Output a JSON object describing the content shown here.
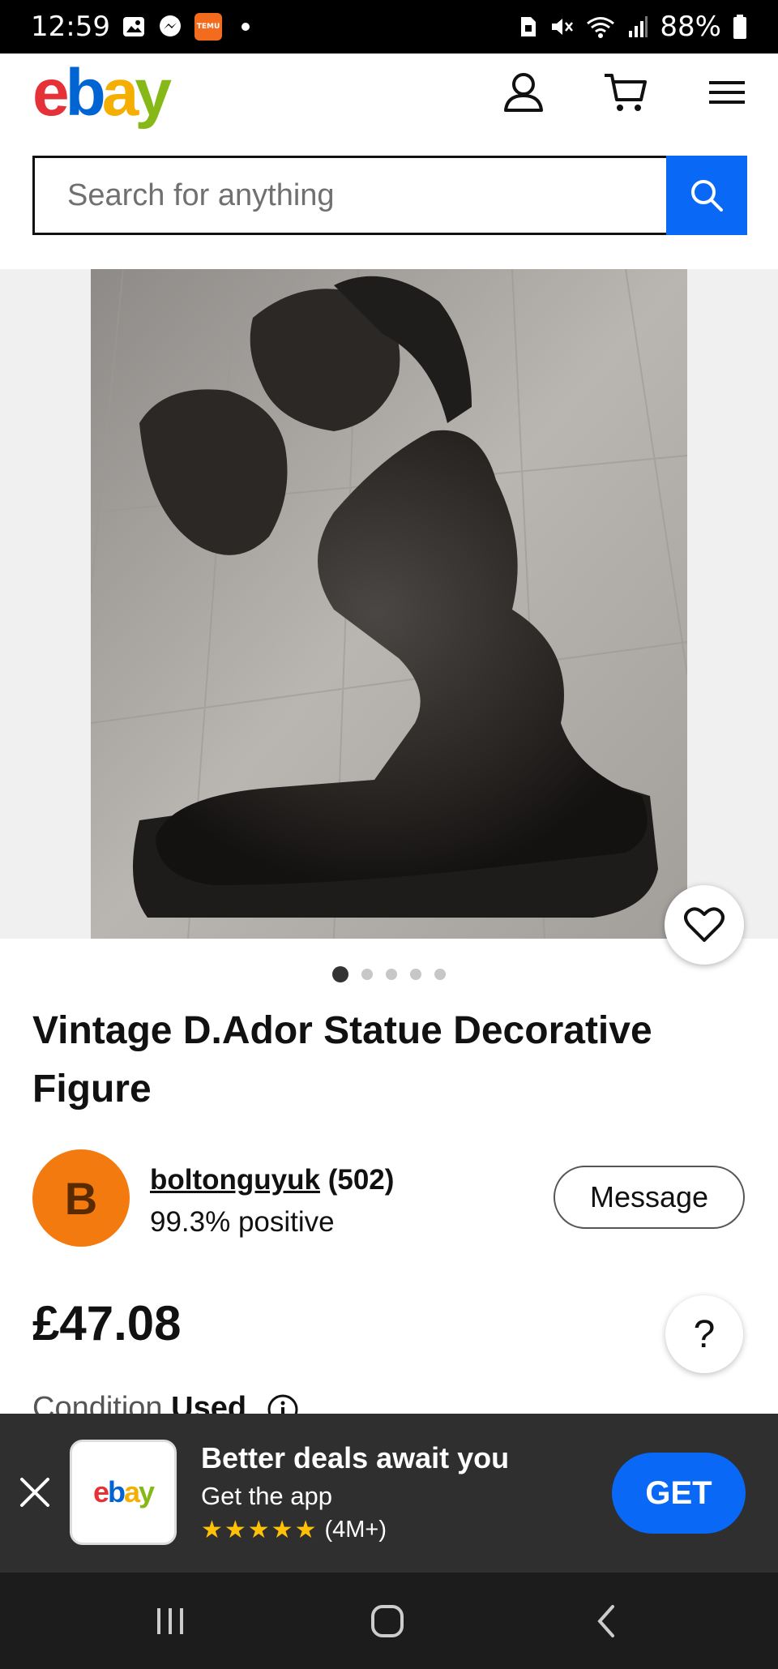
{
  "status_bar": {
    "time": "12:59",
    "battery": "88%",
    "icons": [
      "gallery-icon",
      "messenger-icon",
      "temu-icon",
      "notification-dot",
      "sim-icon",
      "mute-icon",
      "wifi-icon",
      "signal-icon",
      "battery-icon"
    ],
    "temu_label": "TEMU"
  },
  "header": {
    "logo_letters": [
      "e",
      "b",
      "a",
      "y"
    ],
    "icons": [
      "account-icon",
      "cart-icon",
      "menu-icon"
    ]
  },
  "search": {
    "placeholder": "Search for anything",
    "button_icon": "search-icon"
  },
  "gallery": {
    "image_description_icon": "product-photo",
    "page_count": 5,
    "active_index": 0
  },
  "listing": {
    "title": "Vintage D.Ador Statue Decorative Figure",
    "price": "£47.08",
    "condition_label": "Condition",
    "condition_value": "Used"
  },
  "seller": {
    "avatar_letter": "B",
    "name": "boltonguyuk",
    "feedback_count": "(502)",
    "positive": "99.3% positive",
    "message_label": "Message"
  },
  "help": {
    "label": "?"
  },
  "app_banner": {
    "title": "Better deals await you",
    "subtitle": "Get the app",
    "rating_count": "(4M+)",
    "stars": "★★★★★",
    "button": "GET",
    "tile_logo": "ebay"
  },
  "colors": {
    "ebay_red": "#e53238",
    "ebay_blue": "#0064d2",
    "ebay_yellow": "#f5af02",
    "ebay_green": "#86b817",
    "accent_blue": "#0968f6",
    "avatar_orange": "#f37a0f"
  }
}
